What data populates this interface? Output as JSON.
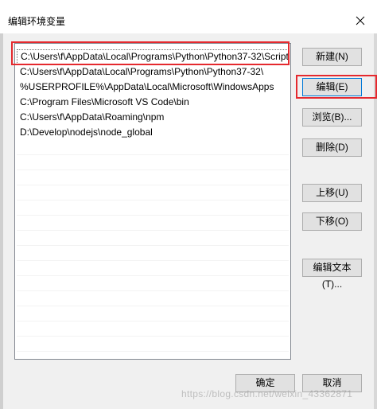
{
  "window": {
    "title": "编辑环境变量"
  },
  "list": {
    "items": [
      {
        "value": "C:\\Users\\f\\AppData\\Local\\Programs\\Python\\Python37-32\\Script..."
      },
      {
        "value": "C:\\Users\\f\\AppData\\Local\\Programs\\Python\\Python37-32\\"
      },
      {
        "value": "%USERPROFILE%\\AppData\\Local\\Microsoft\\WindowsApps"
      },
      {
        "value": "C:\\Program Files\\Microsoft VS Code\\bin"
      },
      {
        "value": "C:\\Users\\f\\AppData\\Roaming\\npm"
      },
      {
        "value": "D:\\Develop\\nodejs\\node_global"
      }
    ],
    "selected_index": 0
  },
  "buttons": {
    "new": "新建(N)",
    "edit": "编辑(E)",
    "browse": "浏览(B)...",
    "delete": "删除(D)",
    "move_up": "上移(U)",
    "move_down": "下移(O)",
    "edit_text": "编辑文本(T)...",
    "ok": "确定",
    "cancel": "取消"
  },
  "watermark": "https://blog.csdn.net/weixin_43362871",
  "colors": {
    "annotation_red": "#e5292e",
    "focus_blue": "#0078d7"
  }
}
